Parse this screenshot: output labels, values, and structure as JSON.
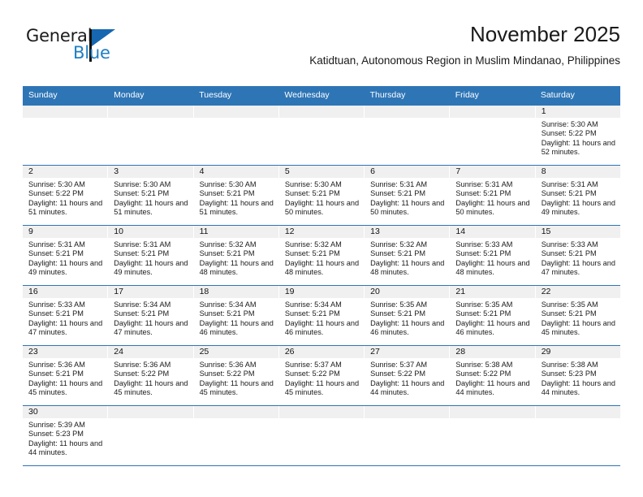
{
  "brand": {
    "name_top": "General",
    "name_bottom": "Blue",
    "triangle_icon": "blue-triangle-icon",
    "color_top": "#1a1a1a",
    "color_bottom": "#1f7fc4"
  },
  "header": {
    "month_title": "November 2025",
    "location": "Katidtuan, Autonomous Region in Muslim Mindanao, Philippines"
  },
  "theme": {
    "header_blue": "#2e75b6",
    "day_band_gray": "#f0f0f0",
    "text_dark": "#1a1a1a"
  },
  "weekdays": [
    {
      "label": "Sunday"
    },
    {
      "label": "Monday"
    },
    {
      "label": "Tuesday"
    },
    {
      "label": "Wednesday"
    },
    {
      "label": "Thursday"
    },
    {
      "label": "Friday"
    },
    {
      "label": "Saturday"
    }
  ],
  "weeks": [
    [
      {
        "day": "",
        "empty": true
      },
      {
        "day": "",
        "empty": true
      },
      {
        "day": "",
        "empty": true
      },
      {
        "day": "",
        "empty": true
      },
      {
        "day": "",
        "empty": true
      },
      {
        "day": "",
        "empty": true
      },
      {
        "day": "1",
        "sunrise": "Sunrise: 5:30 AM",
        "sunset": "Sunset: 5:22 PM",
        "daylight": "Daylight: 11 hours and 52 minutes."
      }
    ],
    [
      {
        "day": "2",
        "sunrise": "Sunrise: 5:30 AM",
        "sunset": "Sunset: 5:22 PM",
        "daylight": "Daylight: 11 hours and 51 minutes."
      },
      {
        "day": "3",
        "sunrise": "Sunrise: 5:30 AM",
        "sunset": "Sunset: 5:21 PM",
        "daylight": "Daylight: 11 hours and 51 minutes."
      },
      {
        "day": "4",
        "sunrise": "Sunrise: 5:30 AM",
        "sunset": "Sunset: 5:21 PM",
        "daylight": "Daylight: 11 hours and 51 minutes."
      },
      {
        "day": "5",
        "sunrise": "Sunrise: 5:30 AM",
        "sunset": "Sunset: 5:21 PM",
        "daylight": "Daylight: 11 hours and 50 minutes."
      },
      {
        "day": "6",
        "sunrise": "Sunrise: 5:31 AM",
        "sunset": "Sunset: 5:21 PM",
        "daylight": "Daylight: 11 hours and 50 minutes."
      },
      {
        "day": "7",
        "sunrise": "Sunrise: 5:31 AM",
        "sunset": "Sunset: 5:21 PM",
        "daylight": "Daylight: 11 hours and 50 minutes."
      },
      {
        "day": "8",
        "sunrise": "Sunrise: 5:31 AM",
        "sunset": "Sunset: 5:21 PM",
        "daylight": "Daylight: 11 hours and 49 minutes."
      }
    ],
    [
      {
        "day": "9",
        "sunrise": "Sunrise: 5:31 AM",
        "sunset": "Sunset: 5:21 PM",
        "daylight": "Daylight: 11 hours and 49 minutes."
      },
      {
        "day": "10",
        "sunrise": "Sunrise: 5:31 AM",
        "sunset": "Sunset: 5:21 PM",
        "daylight": "Daylight: 11 hours and 49 minutes."
      },
      {
        "day": "11",
        "sunrise": "Sunrise: 5:32 AM",
        "sunset": "Sunset: 5:21 PM",
        "daylight": "Daylight: 11 hours and 48 minutes."
      },
      {
        "day": "12",
        "sunrise": "Sunrise: 5:32 AM",
        "sunset": "Sunset: 5:21 PM",
        "daylight": "Daylight: 11 hours and 48 minutes."
      },
      {
        "day": "13",
        "sunrise": "Sunrise: 5:32 AM",
        "sunset": "Sunset: 5:21 PM",
        "daylight": "Daylight: 11 hours and 48 minutes."
      },
      {
        "day": "14",
        "sunrise": "Sunrise: 5:33 AM",
        "sunset": "Sunset: 5:21 PM",
        "daylight": "Daylight: 11 hours and 48 minutes."
      },
      {
        "day": "15",
        "sunrise": "Sunrise: 5:33 AM",
        "sunset": "Sunset: 5:21 PM",
        "daylight": "Daylight: 11 hours and 47 minutes."
      }
    ],
    [
      {
        "day": "16",
        "sunrise": "Sunrise: 5:33 AM",
        "sunset": "Sunset: 5:21 PM",
        "daylight": "Daylight: 11 hours and 47 minutes."
      },
      {
        "day": "17",
        "sunrise": "Sunrise: 5:34 AM",
        "sunset": "Sunset: 5:21 PM",
        "daylight": "Daylight: 11 hours and 47 minutes."
      },
      {
        "day": "18",
        "sunrise": "Sunrise: 5:34 AM",
        "sunset": "Sunset: 5:21 PM",
        "daylight": "Daylight: 11 hours and 46 minutes."
      },
      {
        "day": "19",
        "sunrise": "Sunrise: 5:34 AM",
        "sunset": "Sunset: 5:21 PM",
        "daylight": "Daylight: 11 hours and 46 minutes."
      },
      {
        "day": "20",
        "sunrise": "Sunrise: 5:35 AM",
        "sunset": "Sunset: 5:21 PM",
        "daylight": "Daylight: 11 hours and 46 minutes."
      },
      {
        "day": "21",
        "sunrise": "Sunrise: 5:35 AM",
        "sunset": "Sunset: 5:21 PM",
        "daylight": "Daylight: 11 hours and 46 minutes."
      },
      {
        "day": "22",
        "sunrise": "Sunrise: 5:35 AM",
        "sunset": "Sunset: 5:21 PM",
        "daylight": "Daylight: 11 hours and 45 minutes."
      }
    ],
    [
      {
        "day": "23",
        "sunrise": "Sunrise: 5:36 AM",
        "sunset": "Sunset: 5:21 PM",
        "daylight": "Daylight: 11 hours and 45 minutes."
      },
      {
        "day": "24",
        "sunrise": "Sunrise: 5:36 AM",
        "sunset": "Sunset: 5:22 PM",
        "daylight": "Daylight: 11 hours and 45 minutes."
      },
      {
        "day": "25",
        "sunrise": "Sunrise: 5:36 AM",
        "sunset": "Sunset: 5:22 PM",
        "daylight": "Daylight: 11 hours and 45 minutes."
      },
      {
        "day": "26",
        "sunrise": "Sunrise: 5:37 AM",
        "sunset": "Sunset: 5:22 PM",
        "daylight": "Daylight: 11 hours and 45 minutes."
      },
      {
        "day": "27",
        "sunrise": "Sunrise: 5:37 AM",
        "sunset": "Sunset: 5:22 PM",
        "daylight": "Daylight: 11 hours and 44 minutes."
      },
      {
        "day": "28",
        "sunrise": "Sunrise: 5:38 AM",
        "sunset": "Sunset: 5:22 PM",
        "daylight": "Daylight: 11 hours and 44 minutes."
      },
      {
        "day": "29",
        "sunrise": "Sunrise: 5:38 AM",
        "sunset": "Sunset: 5:23 PM",
        "daylight": "Daylight: 11 hours and 44 minutes."
      }
    ],
    [
      {
        "day": "30",
        "sunrise": "Sunrise: 5:39 AM",
        "sunset": "Sunset: 5:23 PM",
        "daylight": "Daylight: 11 hours and 44 minutes."
      },
      {
        "day": "",
        "empty": true
      },
      {
        "day": "",
        "empty": true
      },
      {
        "day": "",
        "empty": true
      },
      {
        "day": "",
        "empty": true
      },
      {
        "day": "",
        "empty": true
      },
      {
        "day": "",
        "empty": true
      }
    ]
  ]
}
